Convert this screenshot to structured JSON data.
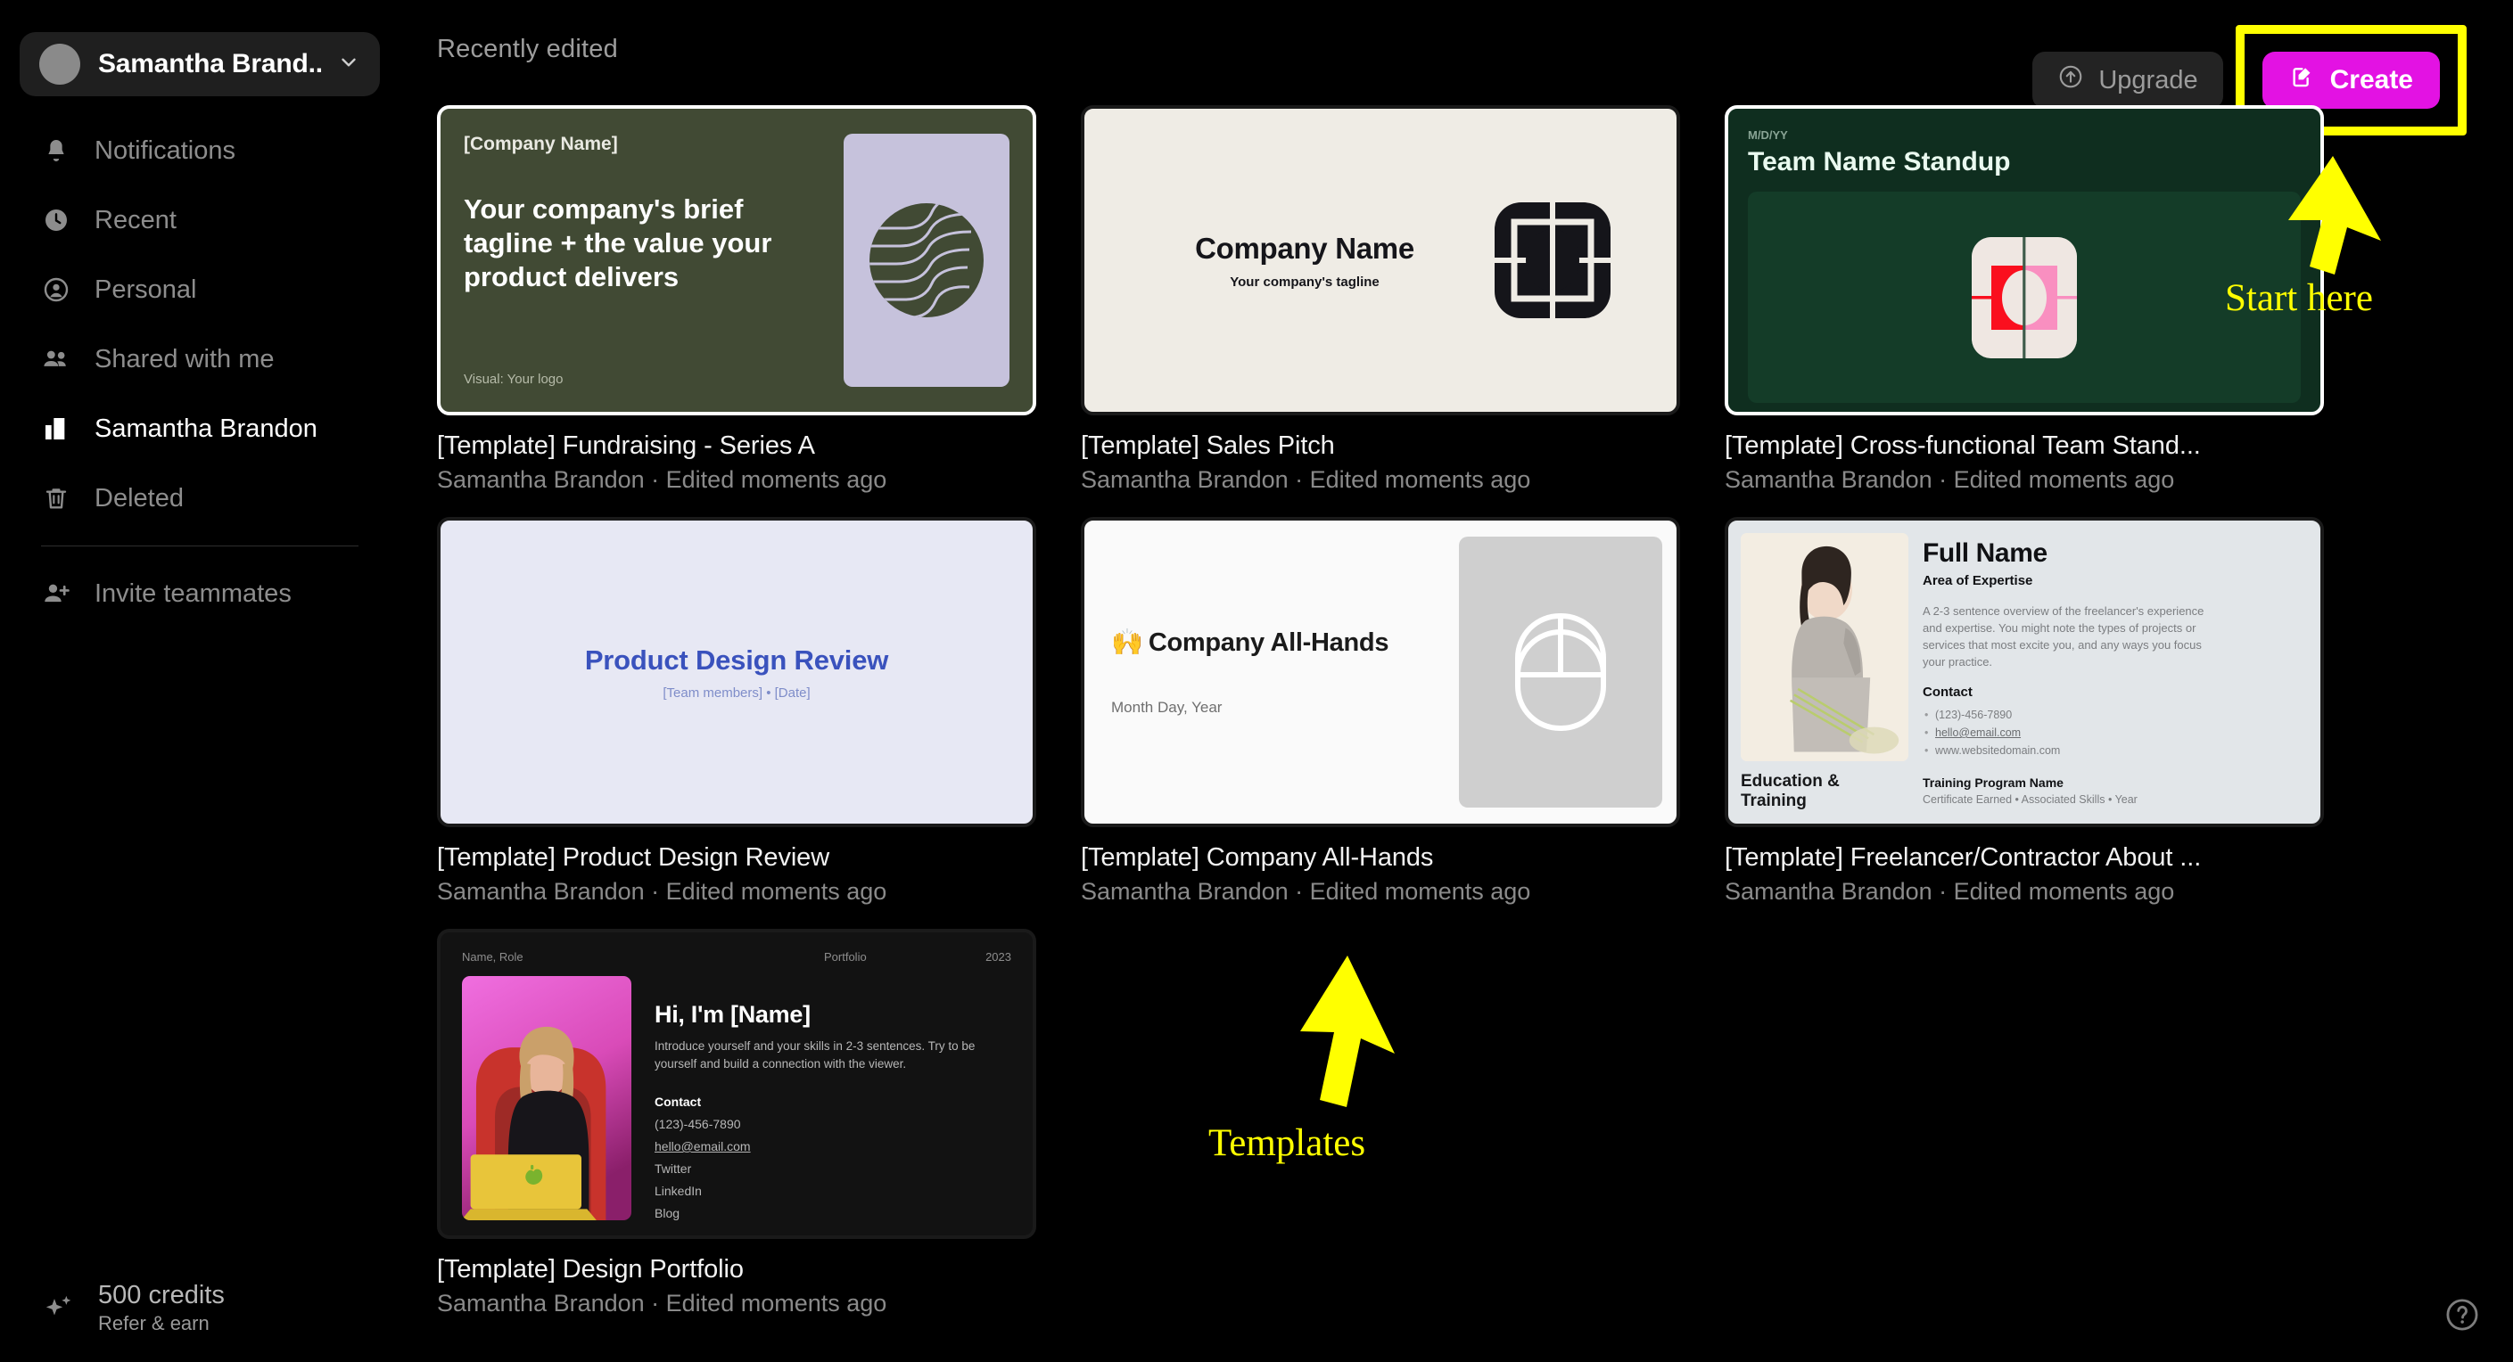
{
  "sidebar": {
    "profile": {
      "name": "Samantha Brand...",
      "chevron_icon": "chevron-down-icon"
    },
    "items": [
      {
        "label": "Notifications",
        "icon": "bell-icon",
        "active": false
      },
      {
        "label": "Recent",
        "icon": "clock-icon",
        "active": false
      },
      {
        "label": "Personal",
        "icon": "person-circle-icon",
        "active": false
      },
      {
        "label": "Shared with me",
        "icon": "people-icon",
        "active": false
      },
      {
        "label": "Samantha Brandon",
        "icon": "building-icon",
        "active": true
      },
      {
        "label": "Deleted",
        "icon": "trash-icon",
        "active": false
      }
    ],
    "invite": {
      "label": "Invite teammates",
      "icon": "person-add-icon"
    },
    "credits": {
      "amount": "500 credits",
      "sub": "Refer & earn",
      "icon": "sparkle-icon"
    }
  },
  "topbar": {
    "section_title": "Recently edited",
    "upgrade_label": "Upgrade",
    "upgrade_icon": "arrow-up-circle-icon",
    "create_label": "Create",
    "create_icon": "compose-icon"
  },
  "colors": {
    "accent_create": "#e312e3",
    "highlight": "#ffff00",
    "background": "#000000",
    "sidebar_active_bg": "#1f1f1f"
  },
  "annotations": [
    {
      "text": "Start here",
      "color": "#ffff00",
      "arrow": "up"
    },
    {
      "text": "Templates",
      "color": "#ffff00",
      "arrow": "up"
    }
  ],
  "help_button": {
    "icon": "question-circle-icon"
  },
  "cards": [
    {
      "title": "[Template] Fundraising - Series A",
      "meta": "Samantha Brandon · Edited moments ago",
      "selected": true,
      "thumb": {
        "company_name": "[Company Name]",
        "tagline": "Your company's brief tagline + the value your product delivers",
        "visual_note": "Visual: Your logo"
      }
    },
    {
      "title": "[Template] Sales Pitch",
      "meta": "Samantha Brandon · Edited moments ago",
      "selected": false,
      "thumb": {
        "company_name": "Company Name",
        "tagline": "Your company's tagline"
      }
    },
    {
      "title": "[Template] Cross-functional Team Stand...",
      "meta": "Samantha Brandon · Edited moments ago",
      "selected": true,
      "thumb": {
        "date": "M/D/YY",
        "heading": "Team Name Standup"
      }
    },
    {
      "title": "[Template] Product Design Review",
      "meta": "Samantha Brandon · Edited moments ago",
      "selected": false,
      "thumb": {
        "heading": "Product Design Review",
        "sub": "[Team members] • [Date]"
      }
    },
    {
      "title": "[Template] Company All-Hands",
      "meta": "Samantha Brandon · Edited moments ago",
      "selected": false,
      "thumb": {
        "heading": "Company All-Hands",
        "emoji": "🙌",
        "date": "Month Day, Year"
      }
    },
    {
      "title": "[Template] Freelancer/Contractor About ...",
      "meta": "Samantha Brandon · Edited moments ago",
      "selected": false,
      "thumb": {
        "caption": "Education & Training",
        "full_name": "Full Name",
        "area": "Area of Expertise",
        "overview": "A 2-3 sentence overview of the freelancer's experience and expertise. You might note the types of projects or services that most excite you, and any ways you focus your practice.",
        "contact_label": "Contact",
        "contact": [
          "(123)-456-7890",
          "hello@email.com",
          "www.websitedomain.com"
        ],
        "training_title": "Training Program Name",
        "training_sub": "Certificate Earned • Associated Skills • Year"
      }
    },
    {
      "title": "[Template] Design Portfolio",
      "meta": "Samantha Brandon · Edited moments ago",
      "selected": false,
      "thumb": {
        "hdr_left": "Name, Role",
        "hdr_mid": "Portfolio",
        "hdr_right": "2023",
        "heading": "Hi, I'm [Name]",
        "sub": "Introduce yourself and your skills in 2-3 sentences. Try to be yourself and build a connection with the viewer.",
        "contact_label": "Contact",
        "contact": [
          "(123)-456-7890",
          "hello@email.com",
          "Twitter",
          "LinkedIn",
          "Blog"
        ]
      }
    }
  ]
}
